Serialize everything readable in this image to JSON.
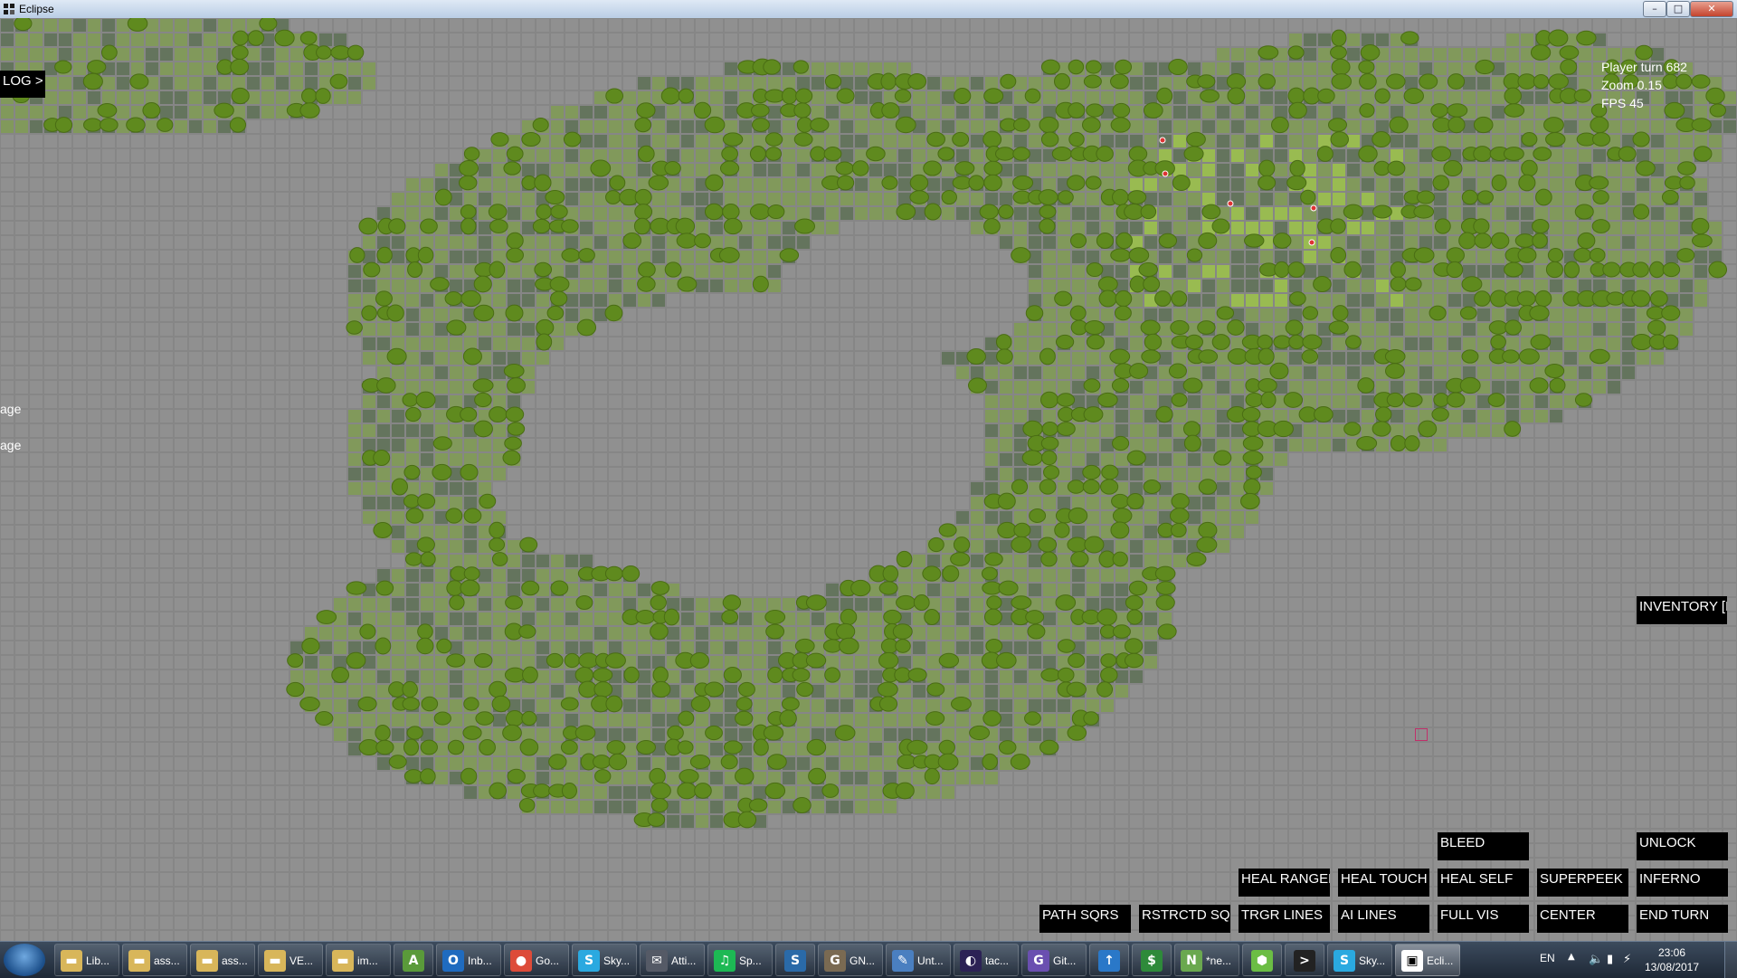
{
  "window": {
    "title": "Eclipse"
  },
  "hud": {
    "log_label": "LOG >",
    "stats": {
      "player_turn": "Player turn 682",
      "zoom": "Zoom 0.15",
      "fps": "FPS 45"
    },
    "side_labels": [
      "age",
      "age"
    ],
    "inventory_label": "INVENTORY [I]",
    "buttons": {
      "bleed": "BLEED",
      "unlock": "UNLOCK",
      "heal_ranged": "HEAL RANGED",
      "heal_touch": "HEAL TOUCH",
      "heal_self": "HEAL SELF",
      "superpeek": "SUPERPEEK",
      "inferno": "INFERNO",
      "path_sqrs": "PATH SQRS",
      "rstrctd_sqrs": "RSTRCTD SQRS",
      "trgr_lines": "TRGR LINES",
      "ai_lines": "AI LINES",
      "full_vis": "FULL VIS",
      "center": "CENTER",
      "end_turn": "END TURN"
    }
  },
  "map": {
    "floor_color": "#909090",
    "grid_color": "#858585",
    "grass_color": "#7f9a55",
    "dark_tile_color": "#5f7158",
    "tree_color": "#5f8a1e",
    "highlight_color": "#9ac04a",
    "marker_color": "#c0306a"
  },
  "taskbar": {
    "items": [
      {
        "label": "Lib...",
        "icon": "folder-icon",
        "color": "#d8b65a"
      },
      {
        "label": "ass...",
        "icon": "folder-icon",
        "color": "#d8b65a"
      },
      {
        "label": "ass...",
        "icon": "folder-icon",
        "color": "#d8b65a"
      },
      {
        "label": "VE...",
        "icon": "folder-icon",
        "color": "#d8b65a"
      },
      {
        "label": "im...",
        "icon": "folder-icon",
        "color": "#d8b65a"
      },
      {
        "label": "",
        "icon": "android-studio-icon",
        "color": "#5a9a3a"
      },
      {
        "label": "Inb...",
        "icon": "outlook-icon",
        "color": "#1f6bbf"
      },
      {
        "label": "Go...",
        "icon": "chrome-icon",
        "color": "#dd4b39"
      },
      {
        "label": "Sky...",
        "icon": "skype-icon",
        "color": "#2aa9e0"
      },
      {
        "label": "Atti...",
        "icon": "chat-icon",
        "color": "#555a66"
      },
      {
        "label": "Sp...",
        "icon": "spotify-icon",
        "color": "#1db954"
      },
      {
        "label": "",
        "icon": "steam-icon",
        "color": "#2a6aa8"
      },
      {
        "label": "GN...",
        "icon": "gimp-icon",
        "color": "#7a6a52"
      },
      {
        "label": "Unt...",
        "icon": "paint-icon",
        "color": "#4a7fc0"
      },
      {
        "label": "tac...",
        "icon": "eclipse-icon",
        "color": "#2c2255"
      },
      {
        "label": "Git...",
        "icon": "github-icon",
        "color": "#6a4fb0"
      },
      {
        "label": "",
        "icon": "upload-icon",
        "color": "#2a78c8"
      },
      {
        "label": "",
        "icon": "dollar-icon",
        "color": "#2e8a3a"
      },
      {
        "label": "*ne...",
        "icon": "notepad-icon",
        "color": "#6aa84f"
      },
      {
        "label": "",
        "icon": "hexagon-icon",
        "color": "#6bbd44"
      },
      {
        "label": "",
        "icon": "terminal-icon",
        "color": "#222222"
      },
      {
        "label": "Sky...",
        "icon": "skype-icon",
        "color": "#2aa9e0"
      },
      {
        "label": "Ecli...",
        "icon": "game-window-icon",
        "color": "#ffffff"
      }
    ],
    "language": "EN",
    "clock_time": "23:06",
    "clock_date": "13/08/2017"
  }
}
